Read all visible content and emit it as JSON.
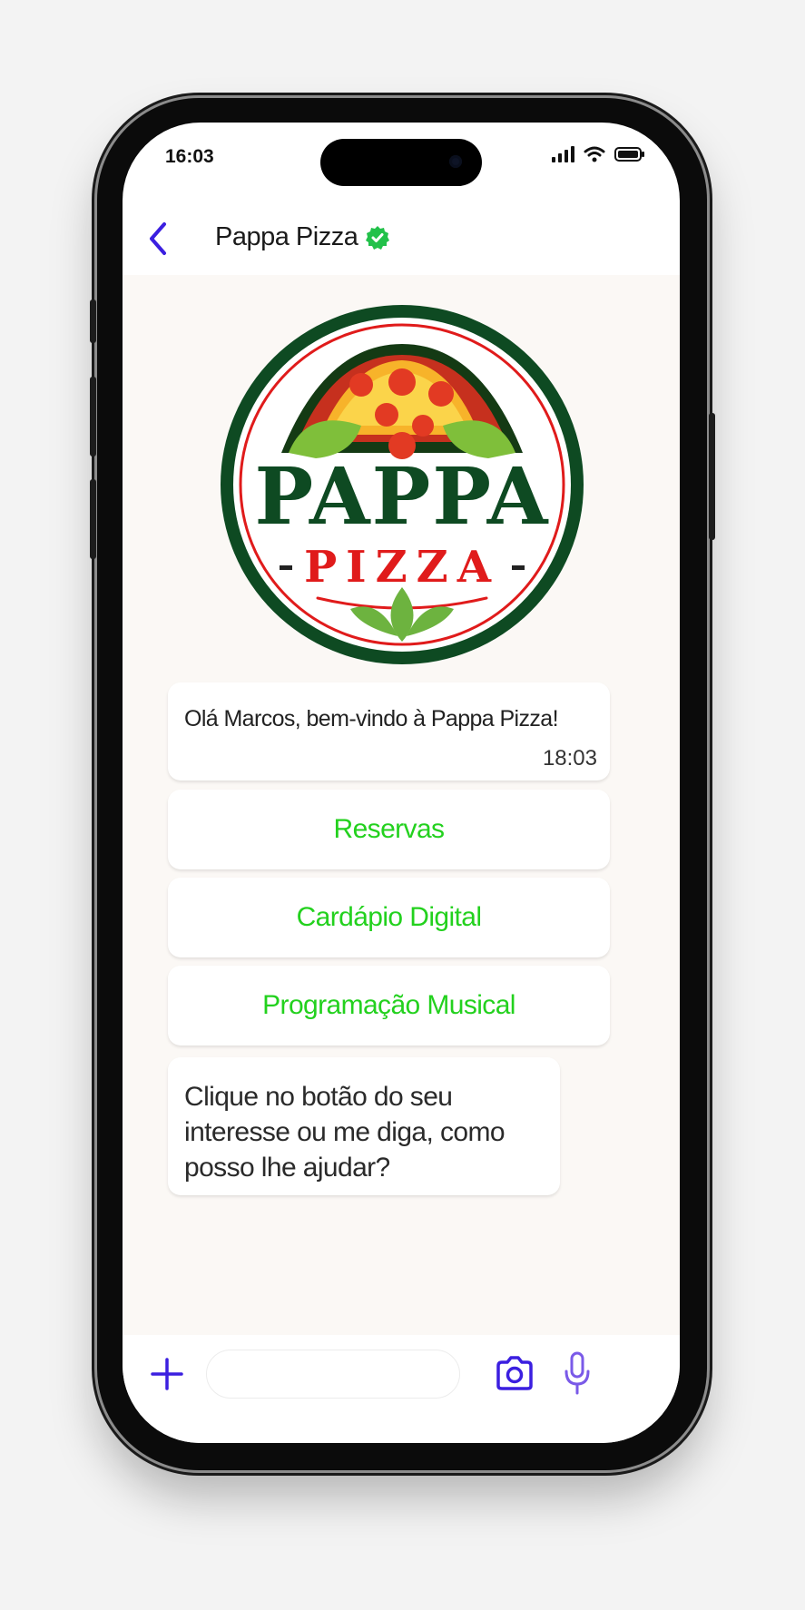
{
  "status_bar": {
    "time": "16:03"
  },
  "header": {
    "title": "Pappa Pizza"
  },
  "logo": {
    "word1": "PAPPA",
    "word2": "PIZZA"
  },
  "messages": {
    "welcome": {
      "text": "Olá Marcos, bem-vindo à Pappa Pizza!",
      "time": "18:03"
    },
    "prompt": {
      "text": "Clique no botão do seu interesse ou me diga, como posso lhe ajudar?"
    }
  },
  "quick_replies": [
    "Reservas",
    "Cardápio Digital",
    "Programação Musical"
  ],
  "composer": {
    "placeholder": ""
  },
  "colors": {
    "accent": "#3b1fe0",
    "verified": "#22c14a",
    "button_text": "#23d11e",
    "chat_bg": "#fbf8f5",
    "logo_green": "#0e4a22",
    "logo_red": "#e01b1b"
  },
  "icons": [
    "back-arrow-icon",
    "verified-badge-icon",
    "plus-icon",
    "camera-icon",
    "microphone-icon",
    "signal-icon",
    "wifi-icon",
    "battery-icon"
  ]
}
